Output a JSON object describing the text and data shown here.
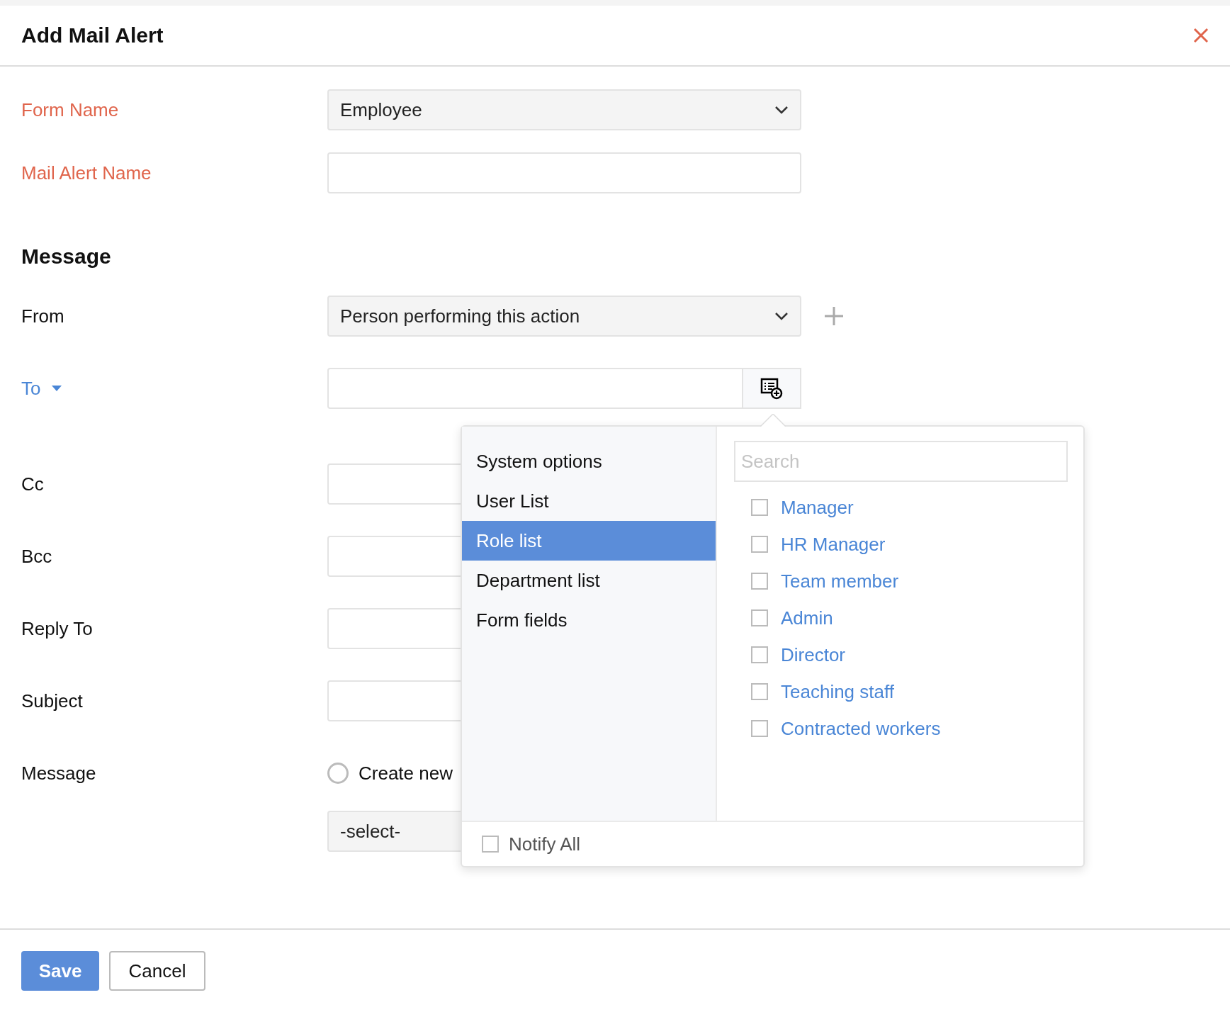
{
  "dialog": {
    "title": "Add Mail Alert"
  },
  "top_fields": [
    {
      "label": "Form Name",
      "required": true,
      "kind": "select",
      "value": "Employee"
    },
    {
      "label": "Mail Alert Name",
      "required": true,
      "kind": "text"
    }
  ],
  "message_section": {
    "heading": "Message",
    "fields": [
      {
        "label": "From",
        "kind": "select",
        "value": "Person performing this action"
      },
      {
        "label": "To",
        "kind": "recipient"
      },
      {
        "label": "Cc",
        "kind": "text"
      },
      {
        "label": "Bcc",
        "kind": "text"
      },
      {
        "label": "Reply To",
        "kind": "text"
      },
      {
        "label": "Subject",
        "kind": "text"
      },
      {
        "label": "Message",
        "kind": "radio",
        "option": "Create new",
        "selected": false
      },
      {
        "kind": "select",
        "value": "-select-"
      }
    ]
  },
  "recipient_menu": {
    "categories": [
      {
        "label": "System options",
        "selected": false
      },
      {
        "label": "User List",
        "selected": false
      },
      {
        "label": "Role list",
        "selected": true
      },
      {
        "label": "Department list",
        "selected": false
      },
      {
        "label": "Form fields",
        "selected": false
      }
    ],
    "search": {
      "placeholder": "Search"
    },
    "options": [
      {
        "label": "Manager",
        "checked": false
      },
      {
        "label": "HR Manager",
        "checked": false
      },
      {
        "label": "Team member",
        "checked": false
      },
      {
        "label": "Admin",
        "checked": false
      },
      {
        "label": "Director",
        "checked": false
      },
      {
        "label": "Teaching staff",
        "checked": false
      },
      {
        "label": "Contracted workers",
        "checked": false
      }
    ],
    "notify_all": {
      "label": "Notify All",
      "checked": false
    }
  },
  "buttons": [
    {
      "label": "Save",
      "kind": "primary"
    },
    {
      "label": "Cancel",
      "kind": "secondary"
    }
  ]
}
